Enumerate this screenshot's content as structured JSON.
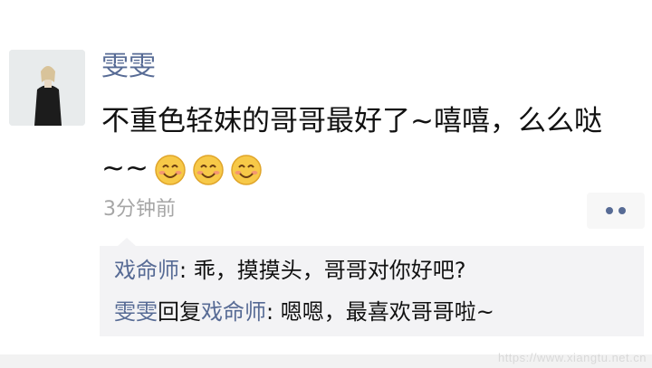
{
  "post": {
    "username": "雯雯",
    "content_text": "不重色轻妹的哥哥最好了~嘻嘻，么么哒~~",
    "emoji": [
      "smile-emoji",
      "smile-emoji",
      "smile-emoji"
    ],
    "timestamp": "3分钟前",
    "more_icon": "more-dots-icon"
  },
  "comments": [
    {
      "author": "戏命师",
      "separator": ": ",
      "text": "乖，摸摸头，哥哥对你好吧?"
    },
    {
      "author": "雯雯",
      "reply_word": "回复",
      "reply_to": "戏命师",
      "separator": ": ",
      "text": "嗯嗯，最喜欢哥哥啦~"
    }
  ],
  "watermark": "https://www.xiangtu.net.cn",
  "colors": {
    "name_blue": "#576b95",
    "timestamp_gray": "#a6a6a6",
    "comment_bg": "#f3f3f5"
  }
}
